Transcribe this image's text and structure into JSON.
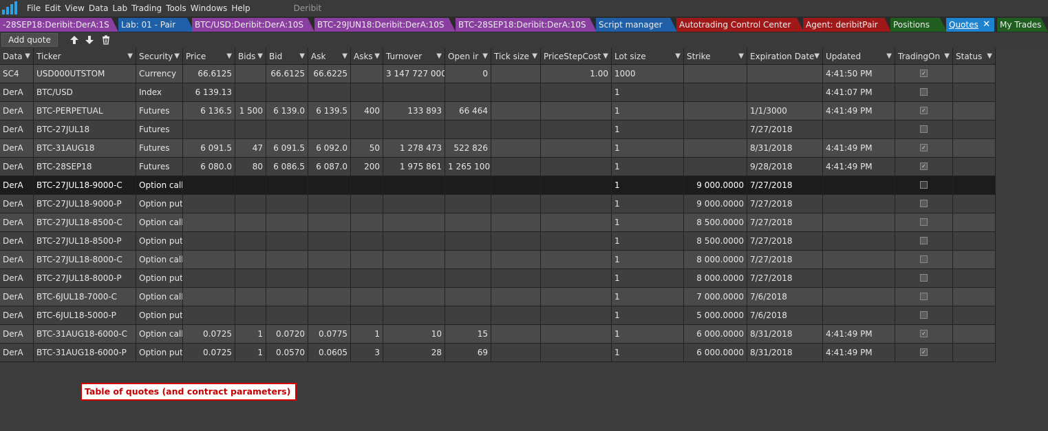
{
  "menubar": {
    "items": [
      "File",
      "Edit",
      "View",
      "Data",
      "Lab",
      "Trading",
      "Tools",
      "Windows",
      "Help"
    ],
    "app_name": "Deribit"
  },
  "tabs": [
    {
      "label": "-28SEP18:Deribit:DerA:1S",
      "color": "purple"
    },
    {
      "label": "Lab: 01 - Pair",
      "color": "blue"
    },
    {
      "label": "BTC/USD:Deribit:DerA:10S",
      "color": "purple"
    },
    {
      "label": "BTC-29JUN18:Deribit:DerA:10S",
      "color": "purple"
    },
    {
      "label": "BTC-28SEP18:Deribit:DerA:10S",
      "color": "purple"
    },
    {
      "label": "Script manager",
      "color": "blue"
    },
    {
      "label": "Autotrading Control Center",
      "color": "red"
    },
    {
      "label": "Agent: deribitPair",
      "color": "red"
    },
    {
      "label": "Positions",
      "color": "green"
    },
    {
      "label": "Quotes",
      "color": "active"
    },
    {
      "label": "My Trades",
      "color": "green"
    }
  ],
  "toolbar": {
    "add_quote_label": "Add quote",
    "icons": [
      "arrow-up-icon",
      "arrow-down-icon",
      "trash-icon"
    ]
  },
  "table": {
    "columns": [
      "Data",
      "Ticker",
      "Security",
      "Price",
      "Bids",
      "Bid",
      "Ask",
      "Asks",
      "Turnover",
      "Open ir",
      "Tick size",
      "PriceStepCost",
      "Lot size",
      "Strike",
      "Expiration Date",
      "Updated",
      "TradingOn",
      "Status"
    ],
    "rows": [
      {
        "data": "SC4",
        "ticker": "USD000UTSTOM",
        "security": "Currency",
        "price": "66.6125",
        "bids": "",
        "bid": "66.6125",
        "ask": "66.6225",
        "asks": "",
        "turnover": "3 147 727 000",
        "open": "0",
        "tick": "",
        "pricestep": "1.00",
        "lot": "1000",
        "strike": "",
        "exp": "",
        "updated": "4:41:50 PM",
        "trading": true,
        "status": ""
      },
      {
        "data": "DerA",
        "ticker": "BTC/USD",
        "security": "Index",
        "price": "6 139.13",
        "bids": "",
        "bid": "",
        "ask": "",
        "asks": "",
        "turnover": "",
        "open": "",
        "tick": "",
        "pricestep": "",
        "lot": "1",
        "strike": "",
        "exp": "",
        "updated": "4:41:07 PM",
        "trading": false,
        "status": ""
      },
      {
        "data": "DerA",
        "ticker": "BTC-PERPETUAL",
        "security": "Futures",
        "price": "6 136.5",
        "bids": "1 500",
        "bid": "6 139.0",
        "ask": "6 139.5",
        "asks": "400",
        "turnover": "133 893",
        "open": "66 464",
        "tick": "",
        "pricestep": "",
        "lot": "1",
        "strike": "",
        "exp": "1/1/3000",
        "updated": "4:41:49 PM",
        "trading": true,
        "status": ""
      },
      {
        "data": "DerA",
        "ticker": "BTC-27JUL18",
        "security": "Futures",
        "price": "",
        "bids": "",
        "bid": "",
        "ask": "",
        "asks": "",
        "turnover": "",
        "open": "",
        "tick": "",
        "pricestep": "",
        "lot": "1",
        "strike": "",
        "exp": "7/27/2018",
        "updated": "",
        "trading": false,
        "status": ""
      },
      {
        "data": "DerA",
        "ticker": "BTC-31AUG18",
        "security": "Futures",
        "price": "6 091.5",
        "bids": "47",
        "bid": "6 091.5",
        "ask": "6 092.0",
        "asks": "50",
        "turnover": "1 278 473",
        "open": "522 826",
        "tick": "",
        "pricestep": "",
        "lot": "1",
        "strike": "",
        "exp": "8/31/2018",
        "updated": "4:41:49 PM",
        "trading": true,
        "status": ""
      },
      {
        "data": "DerA",
        "ticker": "BTC-28SEP18",
        "security": "Futures",
        "price": "6 080.0",
        "bids": "80",
        "bid": "6 086.5",
        "ask": "6 087.0",
        "asks": "200",
        "turnover": "1 975 861",
        "open": "1 265 100",
        "tick": "",
        "pricestep": "",
        "lot": "1",
        "strike": "",
        "exp": "9/28/2018",
        "updated": "4:41:49 PM",
        "trading": true,
        "status": ""
      },
      {
        "data": "DerA",
        "ticker": "BTC-27JUL18-9000-C",
        "security": "Option call",
        "price": "",
        "bids": "",
        "bid": "",
        "ask": "",
        "asks": "",
        "turnover": "",
        "open": "",
        "tick": "",
        "pricestep": "",
        "lot": "1",
        "strike": "9 000.0000",
        "exp": "7/27/2018",
        "updated": "",
        "trading": false,
        "status": "",
        "selected": true
      },
      {
        "data": "DerA",
        "ticker": "BTC-27JUL18-9000-P",
        "security": "Option put",
        "price": "",
        "bids": "",
        "bid": "",
        "ask": "",
        "asks": "",
        "turnover": "",
        "open": "",
        "tick": "",
        "pricestep": "",
        "lot": "1",
        "strike": "9 000.0000",
        "exp": "7/27/2018",
        "updated": "",
        "trading": false,
        "status": ""
      },
      {
        "data": "DerA",
        "ticker": "BTC-27JUL18-8500-C",
        "security": "Option call",
        "price": "",
        "bids": "",
        "bid": "",
        "ask": "",
        "asks": "",
        "turnover": "",
        "open": "",
        "tick": "",
        "pricestep": "",
        "lot": "1",
        "strike": "8 500.0000",
        "exp": "7/27/2018",
        "updated": "",
        "trading": false,
        "status": ""
      },
      {
        "data": "DerA",
        "ticker": "BTC-27JUL18-8500-P",
        "security": "Option put",
        "price": "",
        "bids": "",
        "bid": "",
        "ask": "",
        "asks": "",
        "turnover": "",
        "open": "",
        "tick": "",
        "pricestep": "",
        "lot": "1",
        "strike": "8 500.0000",
        "exp": "7/27/2018",
        "updated": "",
        "trading": false,
        "status": ""
      },
      {
        "data": "DerA",
        "ticker": "BTC-27JUL18-8000-C",
        "security": "Option call",
        "price": "",
        "bids": "",
        "bid": "",
        "ask": "",
        "asks": "",
        "turnover": "",
        "open": "",
        "tick": "",
        "pricestep": "",
        "lot": "1",
        "strike": "8 000.0000",
        "exp": "7/27/2018",
        "updated": "",
        "trading": false,
        "status": ""
      },
      {
        "data": "DerA",
        "ticker": "BTC-27JUL18-8000-P",
        "security": "Option put",
        "price": "",
        "bids": "",
        "bid": "",
        "ask": "",
        "asks": "",
        "turnover": "",
        "open": "",
        "tick": "",
        "pricestep": "",
        "lot": "1",
        "strike": "8 000.0000",
        "exp": "7/27/2018",
        "updated": "",
        "trading": false,
        "status": ""
      },
      {
        "data": "DerA",
        "ticker": "BTC-6JUL18-7000-C",
        "security": "Option call",
        "price": "",
        "bids": "",
        "bid": "",
        "ask": "",
        "asks": "",
        "turnover": "",
        "open": "",
        "tick": "",
        "pricestep": "",
        "lot": "1",
        "strike": "7 000.0000",
        "exp": "7/6/2018",
        "updated": "",
        "trading": false,
        "status": ""
      },
      {
        "data": "DerA",
        "ticker": "BTC-6JUL18-5000-P",
        "security": "Option put",
        "price": "",
        "bids": "",
        "bid": "",
        "ask": "",
        "asks": "",
        "turnover": "",
        "open": "",
        "tick": "",
        "pricestep": "",
        "lot": "1",
        "strike": "5 000.0000",
        "exp": "7/6/2018",
        "updated": "",
        "trading": false,
        "status": ""
      },
      {
        "data": "DerA",
        "ticker": "BTC-31AUG18-6000-C",
        "security": "Option call",
        "price": "0.0725",
        "bids": "1",
        "bid": "0.0720",
        "ask": "0.0775",
        "asks": "1",
        "turnover": "10",
        "open": "15",
        "tick": "",
        "pricestep": "",
        "lot": "1",
        "strike": "6 000.0000",
        "exp": "8/31/2018",
        "updated": "4:41:49 PM",
        "trading": true,
        "status": ""
      },
      {
        "data": "DerA",
        "ticker": "BTC-31AUG18-6000-P",
        "security": "Option put",
        "price": "0.0725",
        "bids": "1",
        "bid": "0.0570",
        "ask": "0.0605",
        "asks": "3",
        "turnover": "28",
        "open": "69",
        "tick": "",
        "pricestep": "",
        "lot": "1",
        "strike": "6 000.0000",
        "exp": "8/31/2018",
        "updated": "4:41:49 PM",
        "trading": true,
        "status": ""
      }
    ]
  },
  "annotation": "Table of quotes (and contract parameters)"
}
